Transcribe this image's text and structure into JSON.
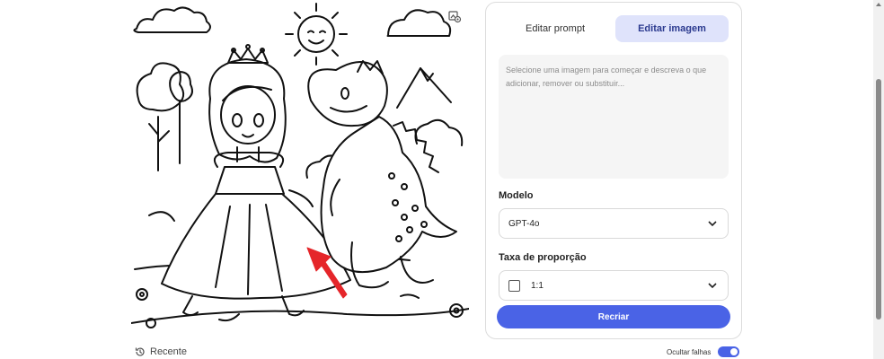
{
  "tabs": [
    {
      "label": "Editar prompt",
      "active": false
    },
    {
      "label": "Editar imagem",
      "active": true
    }
  ],
  "prompt": {
    "placeholder": "Selecione uma imagem para começar e descreva o que adicionar, remover ou substituir..."
  },
  "model": {
    "label": "Modelo",
    "value": "GPT-4o"
  },
  "aspect": {
    "label": "Taxa de proporção",
    "value": "1:1"
  },
  "recreate_label": "Recriar",
  "recent_label": "Recente",
  "hide_fails": {
    "label": "Ocultar falhas",
    "on": true
  },
  "image": {
    "description": "coloring page: princess in gown with crown beside a smiling dinosaur, sun and clouds, red arrow pointing at grass"
  },
  "colors": {
    "accent": "#4a63e6",
    "tab_active_bg": "#dfe3fb",
    "arrow": "#e5262a"
  },
  "icons": [
    "image-edit-icon",
    "chevron-down-icon",
    "history-icon",
    "checkbox-icon"
  ]
}
